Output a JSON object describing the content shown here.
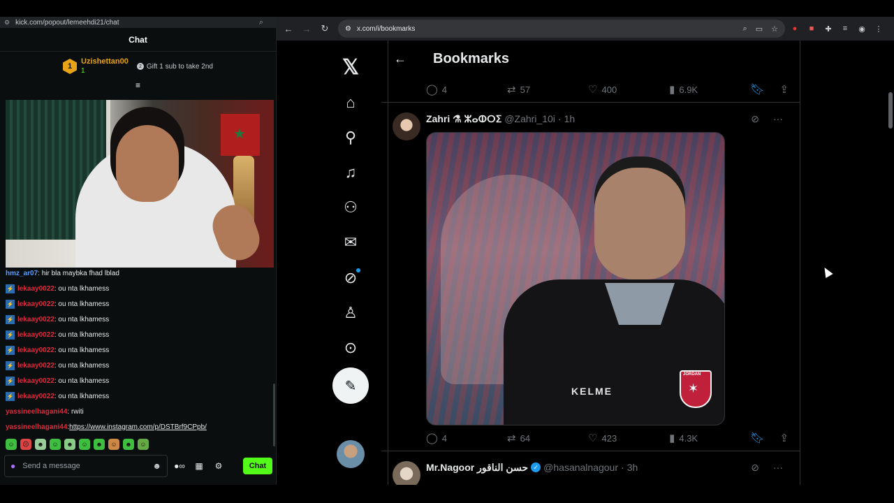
{
  "chat_window": {
    "url": "kick.com/popout/lemeehdi21/chat",
    "header_title": "Chat",
    "gift_leader": {
      "rank": "1",
      "name": "Uzishettan00",
      "count": "1",
      "note": "Gift 1 sub to take 2nd"
    },
    "messages": [
      {
        "user": "hmz_ar07",
        "text": ": hir bla maybka fhad lblad",
        "color": "#5a9cff",
        "badge": false
      },
      {
        "user": "lekaay0022",
        "text": ": ou nta lkhamess",
        "color": "#e02a3c",
        "badge": true
      },
      {
        "user": "lekaay0022",
        "text": ": ou nta lkhamess",
        "color": "#e02a3c",
        "badge": true
      },
      {
        "user": "lekaay0022",
        "text": ": ou nta lkhamess",
        "color": "#e02a3c",
        "badge": true
      },
      {
        "user": "lekaay0022",
        "text": ": ou nta lkhamess",
        "color": "#e02a3c",
        "badge": true
      },
      {
        "user": "lekaay0022",
        "text": ": ou nta lkhamess",
        "color": "#e02a3c",
        "badge": true
      },
      {
        "user": "lekaay0022",
        "text": ": ou nta lkhamess",
        "color": "#e02a3c",
        "badge": true
      },
      {
        "user": "lekaay0022",
        "text": ": ou nta lkhamess",
        "color": "#e02a3c",
        "badge": true
      },
      {
        "user": "lekaay0022",
        "text": ": ou nta lkhamess",
        "color": "#e02a3c",
        "badge": true
      },
      {
        "user": "yassineelhagani44",
        "text": ": rwiti",
        "color": "#e02a3c",
        "badge": false
      },
      {
        "user": "yassineelhagani44",
        "text": ": ",
        "link": "https://www.instagram.com/p/DSTBrf9CPpb/",
        "color": "#e02a3c",
        "badge": false
      }
    ],
    "input_placeholder": "Send a message",
    "send_label": "Chat",
    "accent": "#53fc18"
  },
  "browser": {
    "url": "x.com/i/bookmarks"
  },
  "x": {
    "page_title": "Bookmarks",
    "top_stats": {
      "replies": "4",
      "reposts": "57",
      "likes": "400",
      "views": "6.9K"
    },
    "tweet1": {
      "name": "Zahri ⚗ ⵣⴰⵀⵔⵉ",
      "handle": "@Zahri_10i",
      "time": "1h",
      "media_text": "KELME",
      "crest_text": "JORDAN",
      "stats": {
        "replies": "4",
        "reposts": "64",
        "likes": "423",
        "views": "4.3K"
      }
    },
    "tweet2": {
      "name": "Mr.Nagoor حسن الناقور",
      "handle": "@hasanalnagour",
      "time": "3h"
    },
    "accent": "#1d9bf0"
  }
}
